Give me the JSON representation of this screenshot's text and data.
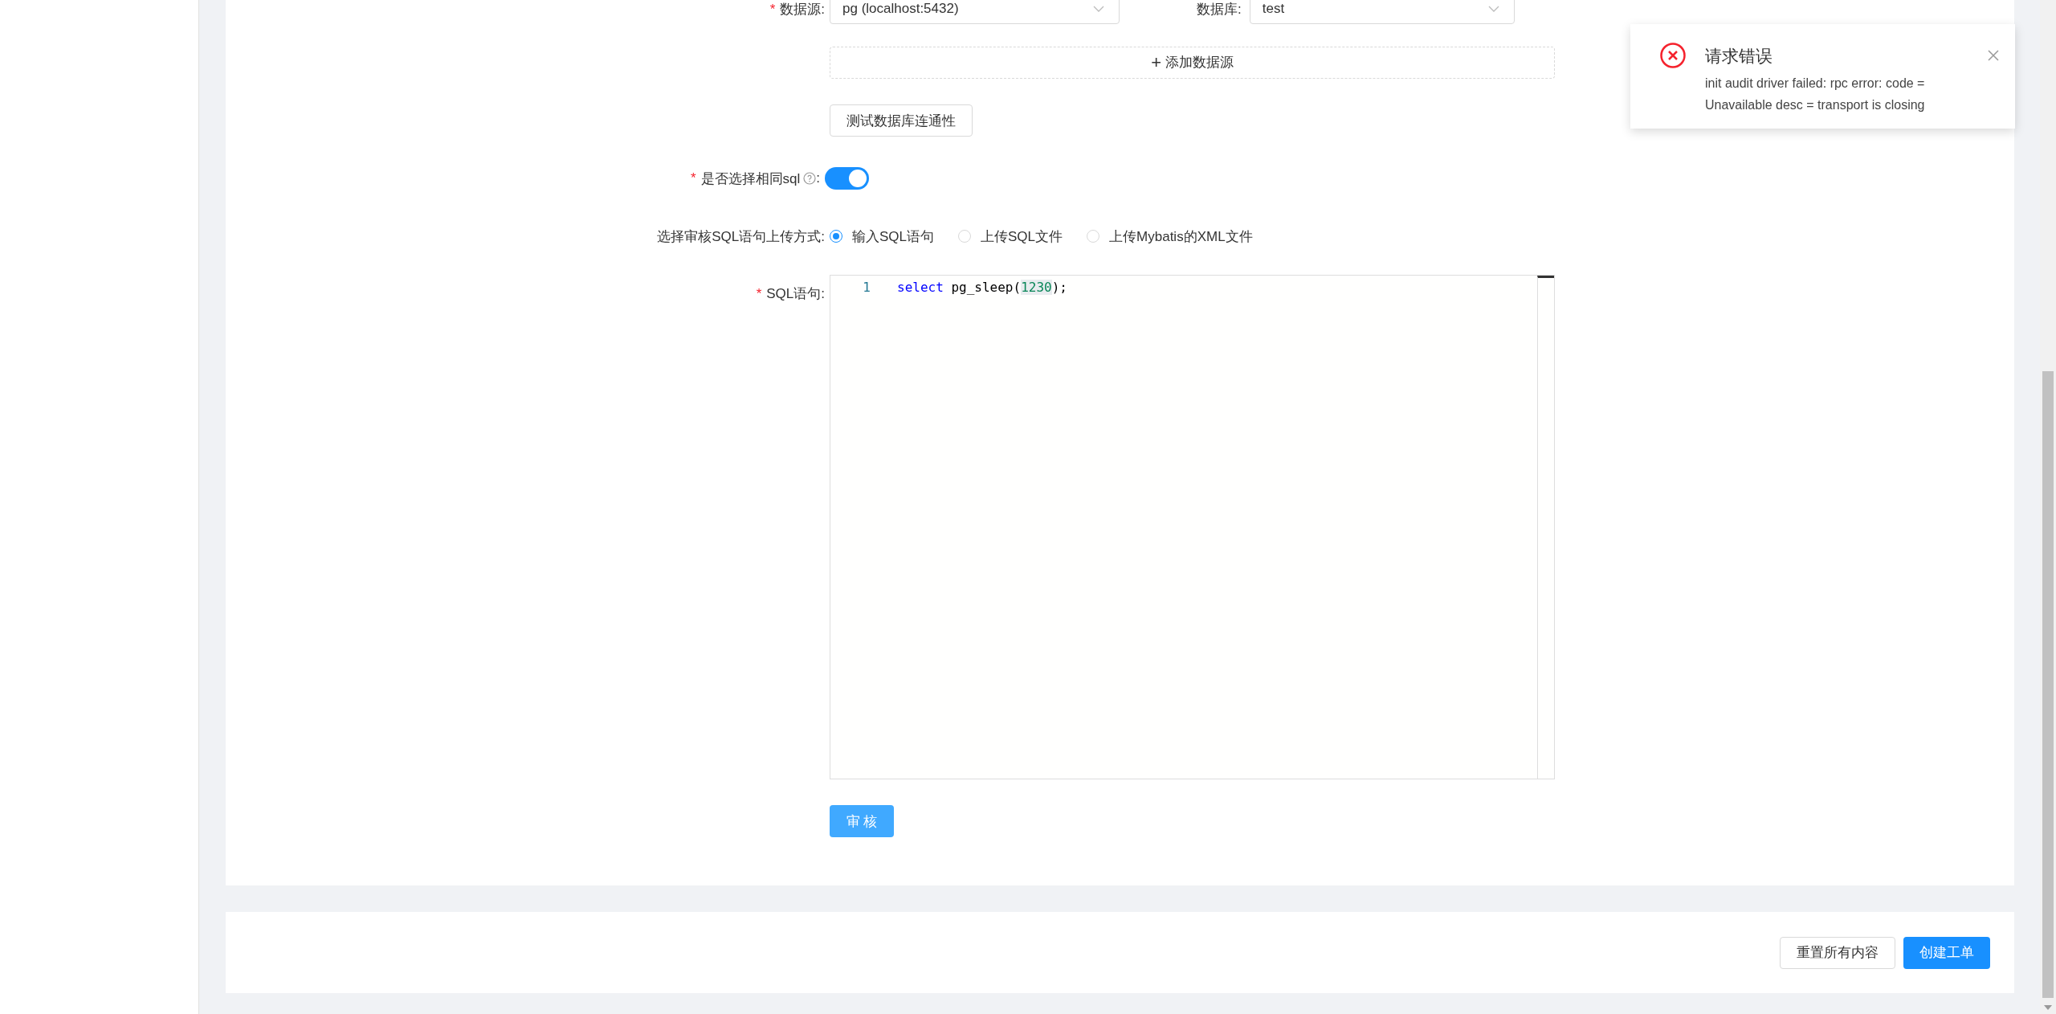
{
  "form": {
    "required_mark": "*",
    "datasource": {
      "label": "数据源:",
      "required": true,
      "value": "pg (localhost:5432)"
    },
    "database": {
      "label": "数据库:",
      "value": "test"
    },
    "add_datasource_button": {
      "icon": "+",
      "label": "添加数据源"
    },
    "test_button": "测试数据库连通性",
    "same_sql": {
      "label": "是否选择相同sql",
      "colon": ":",
      "required": true,
      "on": true
    },
    "upload_mode": {
      "label": "选择审核SQL语句上传方式:",
      "options": [
        {
          "label": "输入SQL语句",
          "selected": true
        },
        {
          "label": "上传SQL文件",
          "selected": false
        },
        {
          "label": "上传Mybatis的XML文件",
          "selected": false
        }
      ]
    },
    "sql": {
      "label": "SQL语句:",
      "required": true,
      "lines": [
        {
          "number": "1",
          "tokens": [
            {
              "kind": "keyword",
              "text": "select"
            },
            {
              "kind": "plain",
              "text": " pg_sleep("
            },
            {
              "kind": "number",
              "text": "1230"
            },
            {
              "kind": "plain",
              "text": ");"
            }
          ]
        }
      ]
    },
    "audit_button": "审 核"
  },
  "footer": {
    "buttons": [
      {
        "label": "重置所有内容",
        "kind": "default"
      },
      {
        "label": "创建工单",
        "kind": "primary"
      }
    ]
  },
  "notification": {
    "title": "请求错误",
    "message": "init audit driver failed: rpc error: code = Unavailable desc = transport is closing"
  }
}
